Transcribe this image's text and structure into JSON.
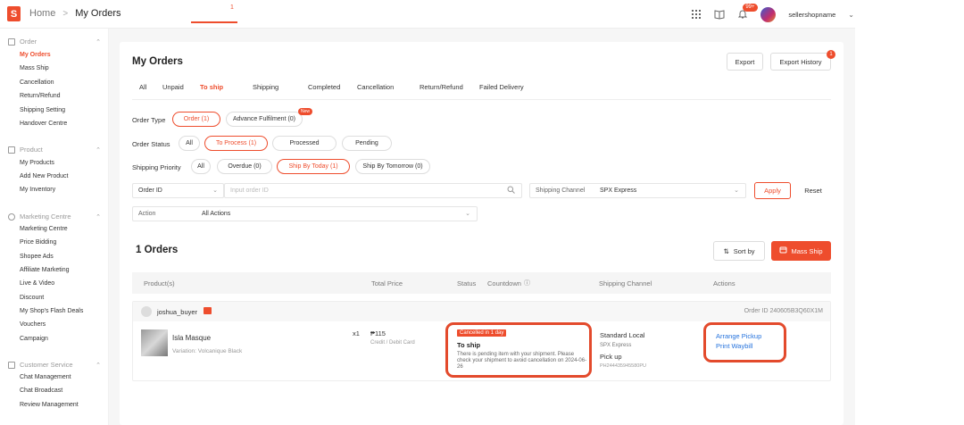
{
  "header": {
    "logo_letter": "S",
    "breadcrumb_home": "Home",
    "breadcrumb_sep": ">",
    "breadcrumb_current": "My Orders",
    "notification_badge": "99+",
    "shop_name": "sellershopname"
  },
  "sidebar": {
    "sections": [
      {
        "label": "Order",
        "items": [
          "My Orders",
          "Mass Ship",
          "Cancellation",
          "Return/Refund",
          "Shipping Setting",
          "Handover Centre"
        ]
      },
      {
        "label": "Product",
        "items": [
          "My Products",
          "Add New Product",
          "My Inventory"
        ]
      },
      {
        "label": "Marketing Centre",
        "items": [
          "Marketing Centre",
          "Price Bidding",
          "Shopee Ads",
          "Affiliate Marketing",
          "Live & Video",
          "Discount",
          "My Shop's Flash Deals",
          "Vouchers",
          "Campaign"
        ]
      },
      {
        "label": "Customer Service",
        "items": [
          "Chat Management",
          "Chat Broadcast",
          "Review Management"
        ]
      }
    ]
  },
  "page": {
    "title": "My Orders",
    "export_label": "Export",
    "export_history_label": "Export History",
    "export_history_badge": "1",
    "tabs": [
      "All",
      "Unpaid",
      "To ship",
      "Shipping",
      "Completed",
      "Cancellation",
      "Return/Refund",
      "Failed Delivery"
    ],
    "active_tab_count": "1"
  },
  "filters": {
    "order_type_label": "Order Type",
    "order_type_options": [
      "Order (1)",
      "Advance Fulfilment (0)"
    ],
    "new_badge": "New",
    "order_status_label": "Order Status",
    "order_status_options": [
      "All",
      "To Process (1)",
      "Processed",
      "Pending"
    ],
    "shipping_priority_label": "Shipping Priority",
    "shipping_priority_options": [
      "All",
      "Overdue (0)",
      "Ship By Today (1)",
      "Ship By Tomorrow (0)"
    ],
    "search_field": "Order ID",
    "search_placeholder": "Input order ID",
    "shipping_channel_label": "Shipping Channel",
    "shipping_channel_value": "SPX Express",
    "apply_label": "Apply",
    "reset_label": "Reset",
    "action_label": "Action",
    "action_value": "All Actions"
  },
  "orders": {
    "count_label": "1  Orders",
    "sort_label": "Sort by",
    "mass_ship_label": "Mass Ship",
    "columns": [
      "Product(s)",
      "Total Price",
      "Status",
      "Countdown",
      "Shipping Channel",
      "Actions"
    ],
    "rows": [
      {
        "buyer": "joshua_buyer",
        "order_id": "Order ID 240605B3Q60X1M",
        "product_name": "Isla Masque",
        "variation": "Variation: Volcanique Black",
        "qty": "x1",
        "price": "₱115",
        "payment": "Credit / Debit Card",
        "status_tag": "Cancelled in 1 day",
        "status_title": "To ship",
        "status_desc": "There is pending item with your shipment. Please check your shipment to avoid cancellation on 2024-06-26",
        "channel_name": "Standard Local",
        "channel_carrier": "SPX Express",
        "channel_method": "Pick up",
        "tracking": "PH244435945580PU",
        "actions": [
          "Arrange Pickup",
          "Print Waybill"
        ]
      }
    ]
  }
}
